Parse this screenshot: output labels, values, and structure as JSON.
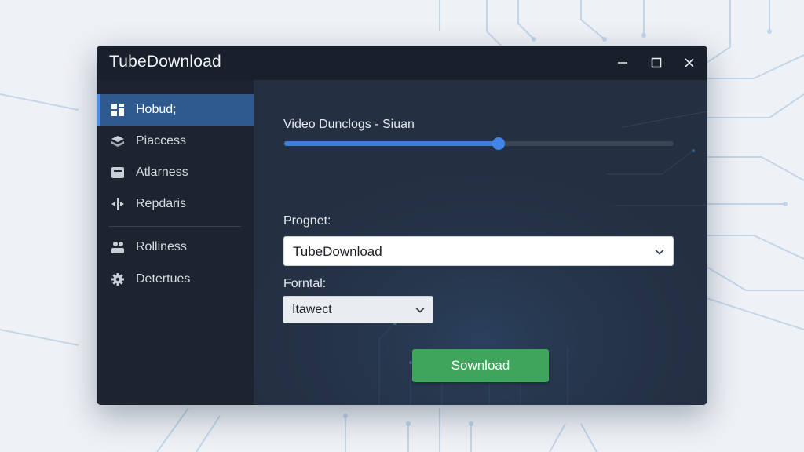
{
  "window": {
    "title": "TubeDownload",
    "controls": {
      "minimize_icon": "minimize-icon",
      "maximize_icon": "maximize-icon",
      "close_icon": "close-icon"
    }
  },
  "sidebar": {
    "items": [
      {
        "label": "Hobud;",
        "icon": "dashboard-grid-icon",
        "active": true
      },
      {
        "label": "Piaccess",
        "icon": "stack-layers-icon",
        "active": false
      },
      {
        "label": "Atlarness",
        "icon": "inbox-tray-icon",
        "active": false
      },
      {
        "label": "Repdaris",
        "icon": "arrows-split-icon",
        "active": false
      },
      {
        "label": "Rolliness",
        "icon": "users-icon",
        "active": false
      },
      {
        "label": "Detertues",
        "icon": "gear-icon",
        "active": false
      }
    ]
  },
  "main": {
    "progress": {
      "label": "Video Dunclogs - Siuan",
      "value": 0.55
    },
    "project": {
      "label": "Prognet:",
      "selected": "TubeDownload"
    },
    "format": {
      "label": "Forntal:",
      "selected": "Itawect"
    },
    "download_button": "Sownload"
  },
  "colors": {
    "accent": "#3d7ed8",
    "active_nav": "#2f5a8f",
    "download": "#3fa45c",
    "window_bg": "#1f2733",
    "titlebar": "#19202b"
  }
}
